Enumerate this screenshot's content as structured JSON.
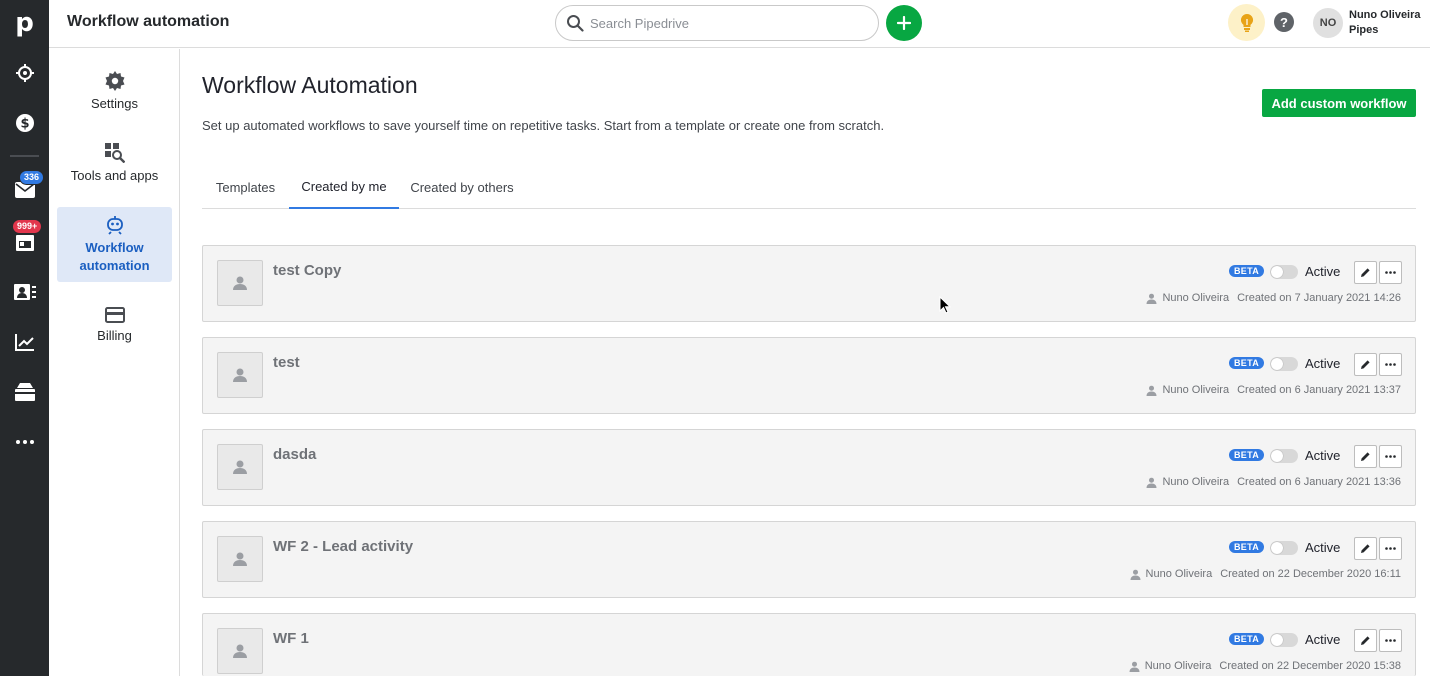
{
  "rail": {
    "logo": "p",
    "mail_badge": "336",
    "activities_badge": "999+"
  },
  "header": {
    "title": "Workflow automation",
    "search_placeholder": "Search Pipedrive",
    "user": {
      "initials": "NO",
      "name": "Nuno Oliveira",
      "company": "Pipes"
    },
    "help_glyph": "?"
  },
  "settings_nav": [
    {
      "label": "Settings",
      "icon": "gear-icon"
    },
    {
      "label": "Tools and apps",
      "icon": "tools-icon"
    },
    {
      "label": "Workflow automation",
      "icon": "robot-icon",
      "active": true
    },
    {
      "label": "Billing",
      "icon": "credit-card-icon"
    }
  ],
  "page": {
    "title": "Workflow Automation",
    "description": "Set up automated workflows to save yourself time on repetitive tasks. Start from a template or create one from scratch.",
    "add_button": "Add custom workflow"
  },
  "tabs": [
    {
      "label": "Templates"
    },
    {
      "label": "Created by me",
      "active": true
    },
    {
      "label": "Created by others"
    }
  ],
  "workflows": [
    {
      "name": "test Copy",
      "badge": "BETA",
      "status": "Active",
      "owner": "Nuno Oliveira",
      "created": "Created on 7 January 2021 14:26"
    },
    {
      "name": "test",
      "badge": "BETA",
      "status": "Active",
      "owner": "Nuno Oliveira",
      "created": "Created on 6 January 2021 13:37"
    },
    {
      "name": "dasda",
      "badge": "BETA",
      "status": "Active",
      "owner": "Nuno Oliveira",
      "created": "Created on 6 January 2021 13:36"
    },
    {
      "name": "WF 2 - Lead activity",
      "badge": "BETA",
      "status": "Active",
      "owner": "Nuno Oliveira",
      "created": "Created on 22 December 2020 16:11"
    },
    {
      "name": "WF 1",
      "badge": "BETA",
      "status": "Active",
      "owner": "Nuno Oliveira",
      "created": "Created on 22 December 2020 15:38"
    }
  ],
  "colors": {
    "rail_bg": "#26292c",
    "primary_green": "#08a742",
    "accent_blue": "#317ae2",
    "active_nav_bg": "#dfe8f7"
  }
}
